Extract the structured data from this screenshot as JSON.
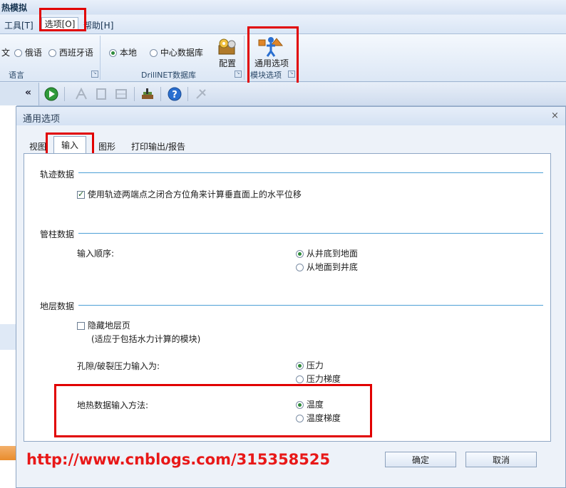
{
  "app": {
    "title": "热模拟"
  },
  "menu": {
    "tools": "工具[T]",
    "options": "选项[O]",
    "help": "帮助[H]"
  },
  "ribbon": {
    "language_group": {
      "partial_lang": "文",
      "russian": "俄语",
      "spanish": "西班牙语",
      "label": "语言"
    },
    "db_group": {
      "local": "本地",
      "central": "中心数据库",
      "config": "配置",
      "label": "DrillNET数据库"
    },
    "module_group": {
      "general_options": "通用选项",
      "label": "模块选项"
    }
  },
  "toolbar": {
    "collapse": "«"
  },
  "dialog": {
    "title": "通用选项",
    "close": "×",
    "tabs": [
      "视图",
      "输入",
      "图形",
      "打印输出/报告"
    ],
    "active_tab": "输入",
    "trajectory": {
      "title": "轨迹数据",
      "checkbox_label": "使用轨迹两端点之闭合方位角来计算垂直面上的水平位移",
      "checked": true
    },
    "tubular": {
      "title": "管柱数据",
      "order_label": "输入顺序:",
      "options": [
        "从井底到地面",
        "从地面到井底"
      ],
      "selected": 0
    },
    "formation": {
      "title": "地层数据",
      "hide_label": "隐藏地层页",
      "hide_note": "(适应于包括水力计算的模块)",
      "hide_checked": false,
      "pressure_label": "孔隙/破裂压力输入为:",
      "pressure_options": [
        "压力",
        "压力梯度"
      ],
      "pressure_selected": 0,
      "thermal_label": "地热数据输入方法:",
      "thermal_options": [
        "温度",
        "温度梯度"
      ],
      "thermal_selected": 0
    },
    "ok": "确定",
    "cancel": "取消"
  },
  "watermark": "http://www.cnblogs.com/315358525",
  "colors": {
    "highlight": "#e10000",
    "section_line": "#4da0d6",
    "accent_green": "#2e8b3b"
  }
}
